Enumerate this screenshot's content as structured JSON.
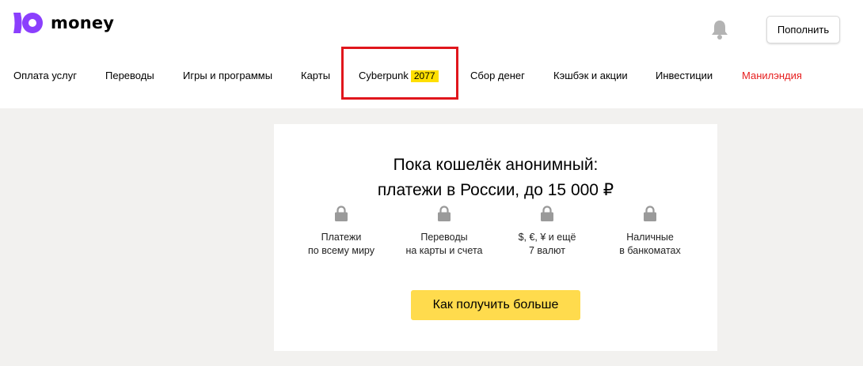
{
  "header": {
    "logo_text": "money",
    "topup_label": "Пополнить",
    "bell_icon": "bell-icon",
    "logo_icon": "yoomoney-logo-icon",
    "brand_color": "#8b3ffd"
  },
  "nav": [
    {
      "label": "Оплата услуг"
    },
    {
      "label": "Переводы"
    },
    {
      "label": "Игры и программы"
    },
    {
      "label": "Карты"
    },
    {
      "label": "Cyberpunk",
      "badge": "2077"
    },
    {
      "label": "Сбор денег"
    },
    {
      "label": "Кэшбэк и акции"
    },
    {
      "label": "Инвестиции"
    },
    {
      "label": "Манилэндия",
      "color": "#e61e1e"
    }
  ],
  "card": {
    "title_line1": "Пока кошелёк анонимный:",
    "title_line2": "платежи в России, до 15 000 ₽",
    "features": [
      {
        "icon": "lock-icon",
        "line1": "Платежи",
        "line2": "по всему миру"
      },
      {
        "icon": "lock-icon",
        "line1": "Переводы",
        "line2": "на карты и счета"
      },
      {
        "icon": "lock-icon",
        "line1": "$, €, ¥ и ещё",
        "line2": "7 валют"
      },
      {
        "icon": "lock-icon",
        "line1": "Наличные",
        "line2": "в банкоматах"
      }
    ],
    "cta_label": "Как получить больше",
    "cta_color": "#ffdb4d"
  },
  "colors": {
    "highlight": "#e0161c",
    "badge": "#ffdf00",
    "page_background": "#f2f1ef"
  }
}
